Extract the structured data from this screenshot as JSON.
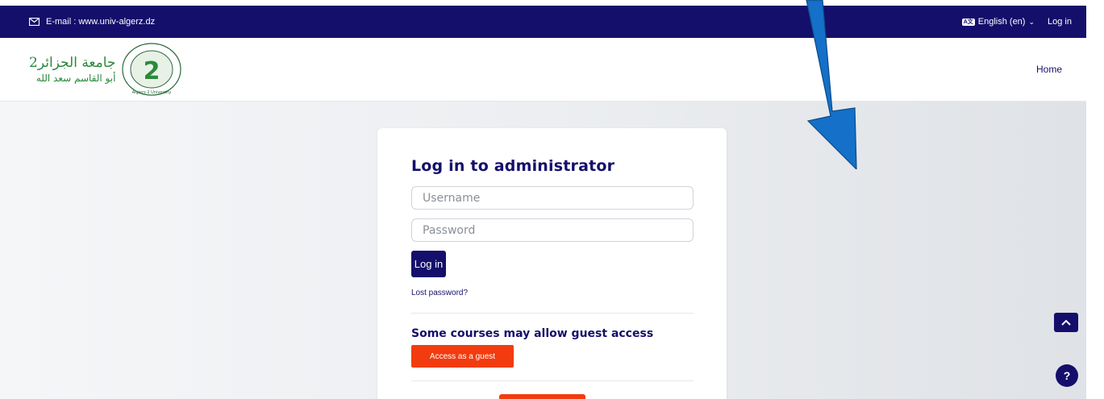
{
  "topbar": {
    "email": "E-mail : www.univ-algerz.dz",
    "language_icon": "language-icon",
    "language": "English (en)",
    "login": "Log in"
  },
  "header": {
    "logo_line1": "جامعة الجزائر2",
    "logo_line2": "أبو القاسم سعد الله",
    "seal_text": "Algiers 2 University",
    "home": "Home"
  },
  "login_card": {
    "title": "Log in to administrator",
    "username_placeholder": "Username",
    "password_placeholder": "Password",
    "login_button": "Log in",
    "lost_password": "Lost password?",
    "guest_title": "Some courses may allow guest access",
    "guest_button": "Access as a guest"
  },
  "floating": {
    "help": "?"
  },
  "colors": {
    "brand": "#140f6b",
    "accent": "#f23c0f",
    "arrow": "#1470c8"
  }
}
